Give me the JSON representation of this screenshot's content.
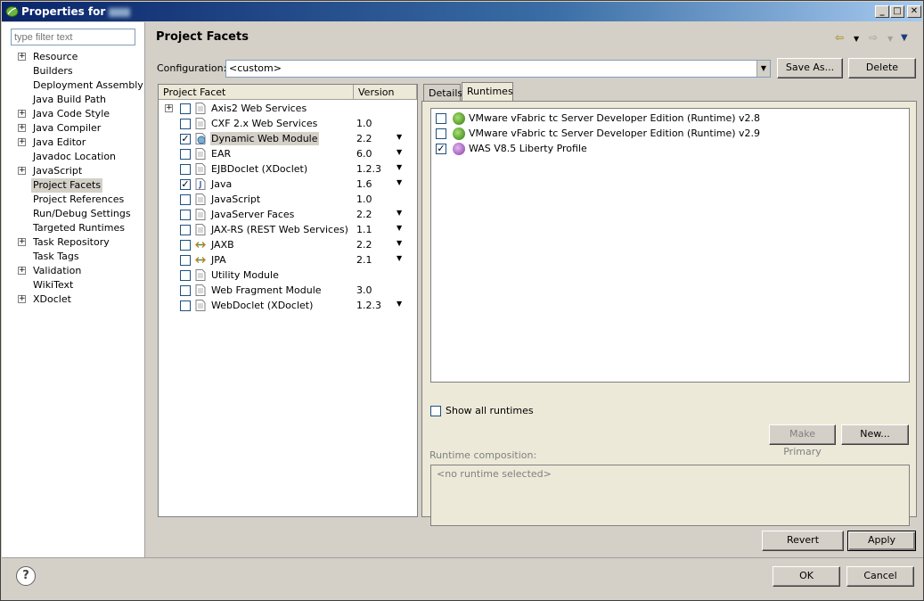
{
  "window": {
    "title": "Properties for"
  },
  "filter": {
    "placeholder": "type filter text"
  },
  "nav": [
    {
      "label": "Resource",
      "expandable": true
    },
    {
      "label": "Builders",
      "expandable": false
    },
    {
      "label": "Deployment Assembly",
      "expandable": false
    },
    {
      "label": "Java Build Path",
      "expandable": false
    },
    {
      "label": "Java Code Style",
      "expandable": true
    },
    {
      "label": "Java Compiler",
      "expandable": true
    },
    {
      "label": "Java Editor",
      "expandable": true
    },
    {
      "label": "Javadoc Location",
      "expandable": false
    },
    {
      "label": "JavaScript",
      "expandable": true
    },
    {
      "label": "Project Facets",
      "expandable": false,
      "selected": true
    },
    {
      "label": "Project References",
      "expandable": false
    },
    {
      "label": "Run/Debug Settings",
      "expandable": false
    },
    {
      "label": "Targeted Runtimes",
      "expandable": false
    },
    {
      "label": "Task Repository",
      "expandable": true
    },
    {
      "label": "Task Tags",
      "expandable": false
    },
    {
      "label": "Validation",
      "expandable": true
    },
    {
      "label": "WikiText",
      "expandable": false
    },
    {
      "label": "XDoclet",
      "expandable": true
    }
  ],
  "main": {
    "title": "Project Facets",
    "config_label": "Configuration:",
    "config_value": "<custom>",
    "save_as": "Save As...",
    "delete": "Delete"
  },
  "facets": {
    "col_facet": "Project Facet",
    "col_version": "Version",
    "rows": [
      {
        "name": "Axis2 Web Services",
        "version": "",
        "checked": false,
        "expandable": true,
        "dropdown": false,
        "icon": "folder-icon"
      },
      {
        "name": "CXF 2.x Web Services",
        "version": "1.0",
        "checked": false,
        "dropdown": false,
        "icon": "page-icon"
      },
      {
        "name": "Dynamic Web Module",
        "version": "2.2",
        "checked": true,
        "dropdown": true,
        "icon": "globe-icon",
        "selected": true
      },
      {
        "name": "EAR",
        "version": "6.0",
        "checked": false,
        "dropdown": true,
        "icon": "page-icon"
      },
      {
        "name": "EJBDoclet (XDoclet)",
        "version": "1.2.3",
        "checked": false,
        "dropdown": true,
        "icon": "page-icon"
      },
      {
        "name": "Java",
        "version": "1.6",
        "checked": true,
        "dropdown": true,
        "icon": "java-icon"
      },
      {
        "name": "JavaScript",
        "version": "1.0",
        "checked": false,
        "dropdown": false,
        "icon": "page-icon"
      },
      {
        "name": "JavaServer Faces",
        "version": "2.2",
        "checked": false,
        "dropdown": true,
        "icon": "page-icon"
      },
      {
        "name": "JAX-RS (REST Web Services)",
        "version": "1.1",
        "checked": false,
        "dropdown": true,
        "icon": "page-icon"
      },
      {
        "name": "JAXB",
        "version": "2.2",
        "checked": false,
        "dropdown": true,
        "icon": "arrows-icon"
      },
      {
        "name": "JPA",
        "version": "2.1",
        "checked": false,
        "dropdown": true,
        "icon": "arrows-icon"
      },
      {
        "name": "Utility Module",
        "version": "",
        "checked": false,
        "dropdown": false,
        "icon": "page-icon"
      },
      {
        "name": "Web Fragment Module",
        "version": "3.0",
        "checked": false,
        "dropdown": false,
        "icon": "page-icon"
      },
      {
        "name": "WebDoclet (XDoclet)",
        "version": "1.2.3",
        "checked": false,
        "dropdown": true,
        "icon": "page-icon"
      }
    ]
  },
  "tabs": {
    "details": "Details",
    "runtimes": "Runtimes"
  },
  "runtimes": {
    "items": [
      {
        "name": "VMware vFabric tc Server Developer Edition (Runtime) v2.8",
        "checked": false,
        "icon": "vfabric-icon"
      },
      {
        "name": "VMware vFabric tc Server Developer Edition (Runtime) v2.9",
        "checked": false,
        "icon": "vfabric-icon"
      },
      {
        "name": "WAS V8.5 Liberty Profile",
        "checked": true,
        "icon": "liberty-icon"
      }
    ],
    "show_all": "Show all runtimes",
    "make_primary": "Make Primary",
    "new": "New...",
    "composition_label": "Runtime composition:",
    "composition_value": "<no runtime selected>"
  },
  "buttons": {
    "revert": "Revert",
    "apply": "Apply",
    "ok": "OK",
    "cancel": "Cancel"
  },
  "colors": {
    "accent": "#0a246a",
    "selection": "#d4d0c8"
  }
}
